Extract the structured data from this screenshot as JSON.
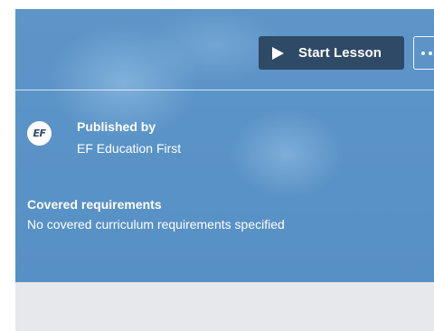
{
  "toolbar": {
    "start_label": "Start Lesson",
    "play_icon": "play-icon",
    "more_icon": "more-options-icon"
  },
  "publisher": {
    "logo_text": "EF",
    "heading": "Published by",
    "name": "EF Education First"
  },
  "requirements": {
    "heading": "Covered requirements",
    "text": "No covered curriculum requirements specified"
  },
  "colors": {
    "hero_blue": "#5a93c7",
    "button_dark": "#2f4a66",
    "footer_gray": "#e6e8ec"
  }
}
